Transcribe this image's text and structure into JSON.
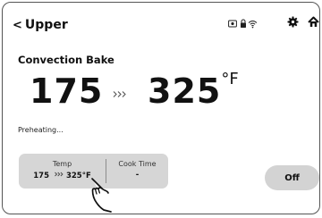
{
  "header": {
    "back_label": "Upper",
    "back_icon": "chevron-left-icon",
    "icons": [
      "remote-icon",
      "lock-icon",
      "wifi-icon",
      "settings-gear-icon",
      "home-icon"
    ]
  },
  "mode": {
    "label": "Convection Bake"
  },
  "temperature": {
    "current": "175",
    "target": "325",
    "unit": "°F",
    "arrow_icon": "triple-arrow-right-icon"
  },
  "status": {
    "text": "Preheating..."
  },
  "controls": {
    "temp_label": "Temp",
    "temp_from": "175",
    "temp_to": "325",
    "temp_unit": "°F",
    "cook_time_label": "Cook Time",
    "cook_time_value": "-"
  },
  "off_button": {
    "label": "Off"
  },
  "colors": {
    "pill_bg": "#d6d6d6",
    "button_bg": "#d3d3d3",
    "text": "#111111"
  }
}
